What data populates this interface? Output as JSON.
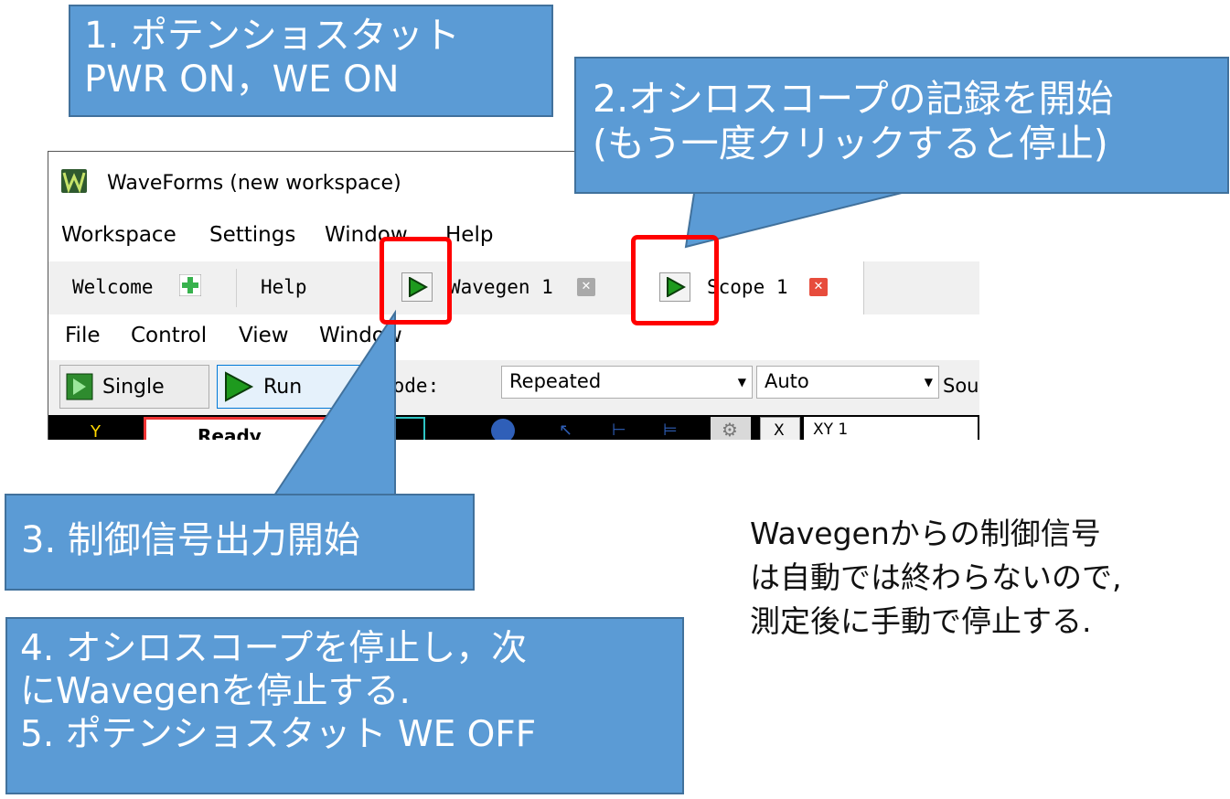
{
  "window": {
    "app_title": "WaveForms  (new workspace)",
    "menus": [
      "Workspace",
      "Settings",
      "Window",
      "Help"
    ],
    "tabs": {
      "welcome": "Welcome",
      "help": "Help",
      "wavegen": "Wavegen 1",
      "scope": "Scope 1"
    },
    "scope_menus": [
      "File",
      "Control",
      "View",
      "Window"
    ],
    "toolbar": {
      "single_label": "Single",
      "run_label": "Run",
      "mode_label": "Mode:",
      "mode_value": "Repeated",
      "trigger_value": "Auto",
      "source_label": "Sou"
    },
    "status_bar": {
      "status_text": "Ready",
      "xy_label": "X",
      "xy_value": "XY 1"
    }
  },
  "callouts": {
    "step1": [
      "1. ポテンショスタット",
      "PWR ON，WE ON"
    ],
    "step2": [
      "2.オシロスコープの記録を開始",
      "(もう一度クリックすると停止)"
    ],
    "step3": [
      "3. 制御信号出力開始"
    ],
    "step45": [
      "4. オシロスコープを停止し，次",
      "にWavegenを停止する.",
      "5. ポテンショスタット WE OFF"
    ]
  },
  "note": [
    "Wavegenからの制御信号",
    "は自動では終わらないので,",
    "測定後に手動で停止する."
  ],
  "colors": {
    "callout_fill": "#5b9bd5",
    "callout_border": "#41719c",
    "highlight": "#ff0000",
    "play_green": "#1e9a1e",
    "close_red": "#e74c3c",
    "close_gray": "#a9a9a9"
  },
  "icons": [
    "waveforms-app-icon",
    "plus-icon",
    "play-icon",
    "close-icon",
    "single-step-icon",
    "gear-icon"
  ]
}
